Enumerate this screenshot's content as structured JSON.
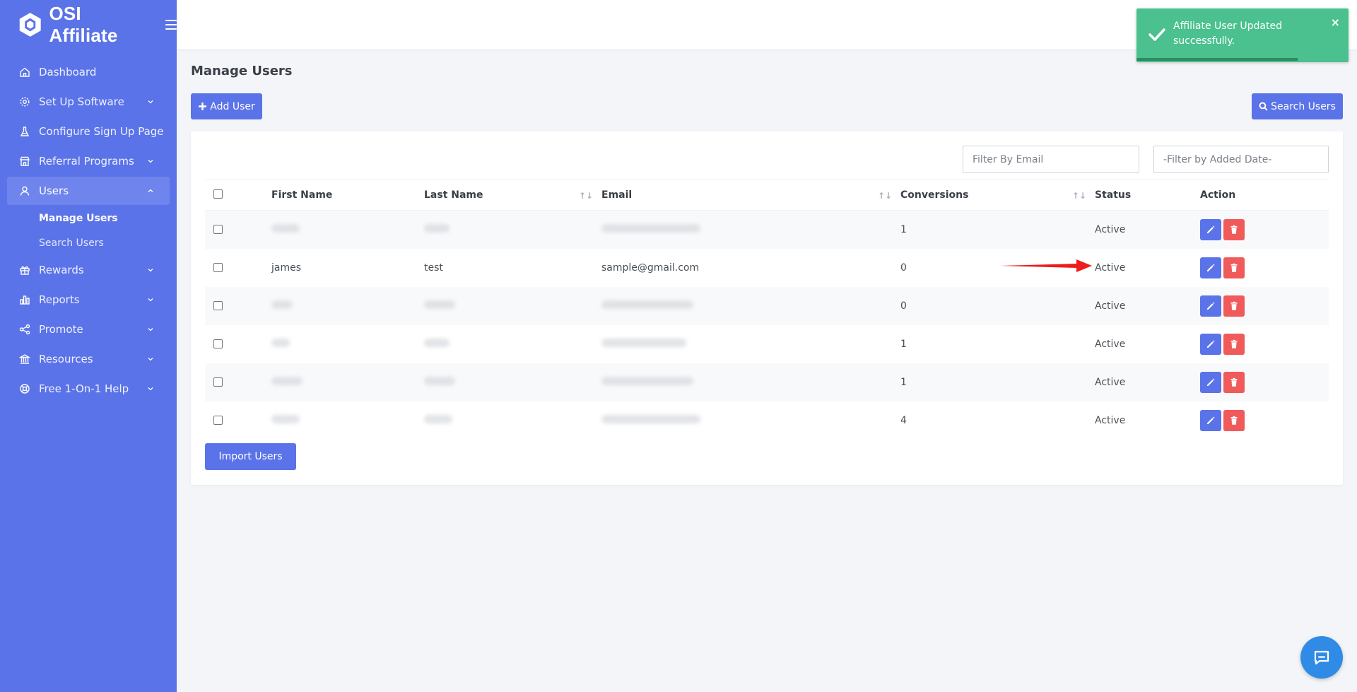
{
  "app": {
    "brand": "OSI Affiliate"
  },
  "sidebar": {
    "items": [
      {
        "label": "Dashboard",
        "icon": "home-icon",
        "has_chevron": false
      },
      {
        "label": "Set Up Software",
        "icon": "gear-icon",
        "has_chevron": true
      },
      {
        "label": "Configure Sign Up Page",
        "icon": "flask-icon",
        "has_chevron": false
      },
      {
        "label": "Referral Programs",
        "icon": "store-icon",
        "has_chevron": true
      },
      {
        "label": "Users",
        "icon": "user-icon",
        "has_chevron": true,
        "expanded": true
      },
      {
        "label": "Rewards",
        "icon": "gift-icon",
        "has_chevron": true
      },
      {
        "label": "Reports",
        "icon": "bar-chart-icon",
        "has_chevron": true
      },
      {
        "label": "Promote",
        "icon": "share-icon",
        "has_chevron": true
      },
      {
        "label": "Resources",
        "icon": "bank-icon",
        "has_chevron": true
      },
      {
        "label": "Free 1-On-1 Help",
        "icon": "lifebuoy-icon",
        "has_chevron": true
      }
    ],
    "users_submenu": [
      "Manage Users",
      "Search Users"
    ]
  },
  "toast": {
    "message": "Affiliate User Updated successfully.",
    "close_label": "×",
    "progress": 0.76
  },
  "main": {
    "title": "Manage Users",
    "add_user_label": "Add User",
    "search_users_label": "Search Users",
    "filter_email_placeholder": "Filter By Email",
    "filter_date_placeholder": "-Filter by Added Date-",
    "import_label": "Import Users"
  },
  "table": {
    "headers": [
      "First Name",
      "Last Name",
      "Email",
      "Conversions",
      "Status",
      "Action"
    ],
    "rows": [
      {
        "first": "",
        "last": "",
        "email": "",
        "conversions": "1",
        "status": "Active",
        "redacted": true
      },
      {
        "first": "james",
        "last": "test",
        "email": "sample@gmail.com",
        "conversions": "0",
        "status": "Active",
        "redacted": false
      },
      {
        "first": "",
        "last": "",
        "email": "",
        "conversions": "0",
        "status": "Active",
        "redacted": true
      },
      {
        "first": "",
        "last": "",
        "email": "",
        "conversions": "1",
        "status": "Active",
        "redacted": true
      },
      {
        "first": "",
        "last": "",
        "email": "",
        "conversions": "1",
        "status": "Active",
        "redacted": true
      },
      {
        "first": "",
        "last": "",
        "email": "",
        "conversions": "4",
        "status": "Active",
        "redacted": true
      }
    ]
  },
  "colors": {
    "sidebar": "#5b73e8",
    "toast": "#4ac18e",
    "delete": "#f15a5a",
    "arrow": "#ee1c1c",
    "chat": "#2f8be6"
  }
}
